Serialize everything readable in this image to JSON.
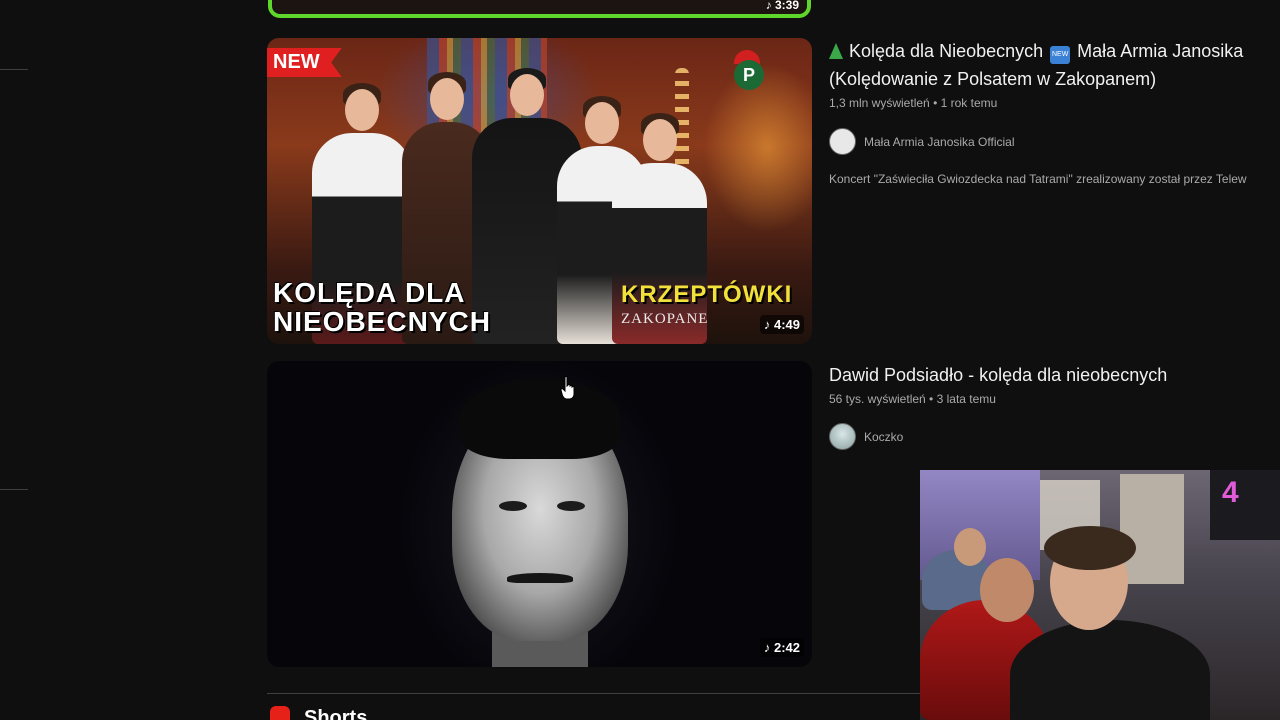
{
  "previous_result": {
    "duration": "3:39"
  },
  "results": [
    {
      "thumbnail": {
        "badge": "NEW",
        "overlay_left": "KOLĘDA DLA\nNIEOBECNYCH",
        "overlay_right": "KRZEPTÓWKI",
        "overlay_sub": "ZAKOPANE",
        "duration": "4:49"
      },
      "title_line1": "Kolęda dla Nieobecnych",
      "title_line1_after": "Mała Armia Janosika",
      "title_line2": "(Kolędowanie z Polsatem w Zakopanem)",
      "views": "1,3 mln wyświetleń",
      "age": "1 rok temu",
      "channel": "Mała Armia Janosika Official",
      "description": "Koncert \"Zaświeciła Gwiozdecka nad Tatrami\" zrealizowany został przez Telew"
    },
    {
      "thumbnail": {
        "duration": "2:42"
      },
      "title": "Dawid Podsiadło - kolęda dla nieobecnych",
      "views": "56 tys. wyświetleń",
      "age": "3 lata temu",
      "channel": "Koczko"
    }
  ],
  "shorts": {
    "label": "Shorts"
  },
  "emoji": {
    "new_badge_text": "NEW"
  },
  "separator": "•",
  "duration_icon": "music-note-icon",
  "colors": {
    "background": "#0f0f0f",
    "accent_green": "#5fd62b",
    "new_badge": "#e02020",
    "shorts_red": "#e62117"
  }
}
